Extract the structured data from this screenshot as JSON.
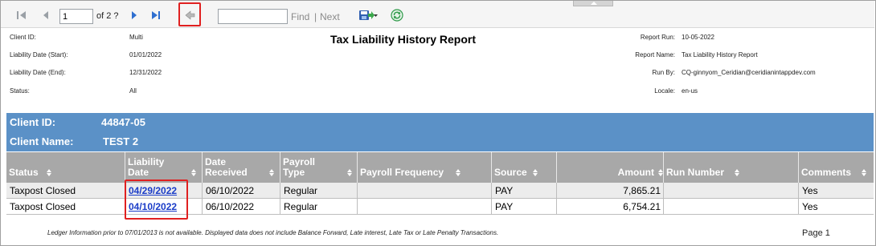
{
  "toolbar": {
    "page_value": "1",
    "page_of": "of 2 ?",
    "find_label": "Find",
    "separator": "|",
    "next_label": "Next"
  },
  "header": {
    "title": "Tax Liability History Report",
    "left": [
      {
        "label": "Client ID:",
        "value": "Multi"
      },
      {
        "label": "Liability Date (Start):",
        "value": "01/01/2022"
      },
      {
        "label": "Liability Date (End):",
        "value": "12/31/2022"
      },
      {
        "label": "Status:",
        "value": "All"
      }
    ],
    "right": [
      {
        "label": "Report Run:",
        "value": "10-05-2022"
      },
      {
        "label": "Report Name:",
        "value": "Tax Liability History Report"
      },
      {
        "label": "Run By:",
        "value": "CQ-ginnyom_Ceridian@ceridianintappdev.com"
      },
      {
        "label": "Locale:",
        "value": "en-us"
      }
    ]
  },
  "client": {
    "id_label": "Client ID:",
    "id_value": "44847-05",
    "name_label": "Client Name:",
    "name_value": "TEST 2"
  },
  "table": {
    "columns": [
      "Status",
      "Liability Date",
      "Date Received",
      "Payroll Type",
      "Payroll Frequency",
      "Source",
      "Amount",
      "Run Number",
      "Comments"
    ],
    "rows": [
      [
        "Taxpost Closed",
        "04/29/2022",
        "06/10/2022",
        "Regular",
        "",
        "PAY",
        "7,865.21",
        "",
        "Yes"
      ],
      [
        "Taxpost Closed",
        "04/10/2022",
        "06/10/2022",
        "Regular",
        "",
        "PAY",
        "6,754.21",
        "",
        "Yes"
      ]
    ]
  },
  "footer": {
    "note": "Ledger Information prior to 07/01/2013 is not available. Displayed data does not include Balance Forward, Late interest, Late Tax or Late Penalty Transactions.",
    "page": "Page 1"
  },
  "colors": {
    "band": "#5b91c7",
    "header": "#a8a8a8",
    "highlight": "#e02020",
    "link": "#1a3cc8"
  }
}
